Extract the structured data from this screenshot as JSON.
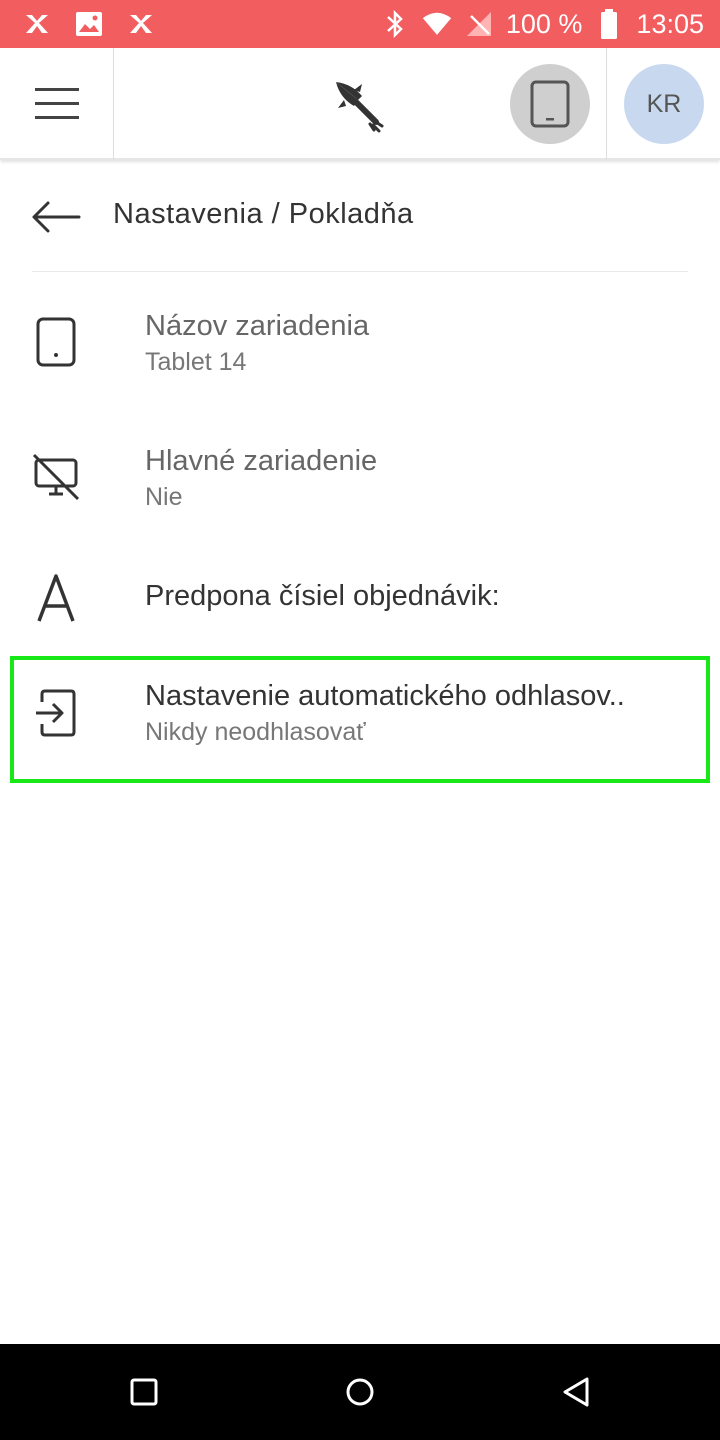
{
  "status_bar": {
    "battery_text": "100 %",
    "time": "13:05",
    "background": "#f25e60"
  },
  "app_bar": {
    "menu_icon": "hamburger-icon",
    "logo_icon": "rocket-fork-logo",
    "device_icon": "tablet-icon",
    "avatar_initials": "KR"
  },
  "header": {
    "title": "Nastavenia / Pokladňa",
    "back_icon": "arrow-left-icon"
  },
  "settings": [
    {
      "icon": "tablet-icon",
      "title": "Názov zariadenia",
      "subtitle": "Tablet 14"
    },
    {
      "icon": "desktop-off-icon",
      "title": "Hlavné zariadenie",
      "subtitle": "Nie"
    },
    {
      "icon": "letter-a-icon",
      "title": "Predpona čísiel objednávik:",
      "subtitle": ""
    },
    {
      "icon": "login-icon",
      "title": "Nastavenie automatického odhlasov..",
      "subtitle": "Nikdy neodhlasovať"
    }
  ],
  "highlight_color": "#18e818"
}
